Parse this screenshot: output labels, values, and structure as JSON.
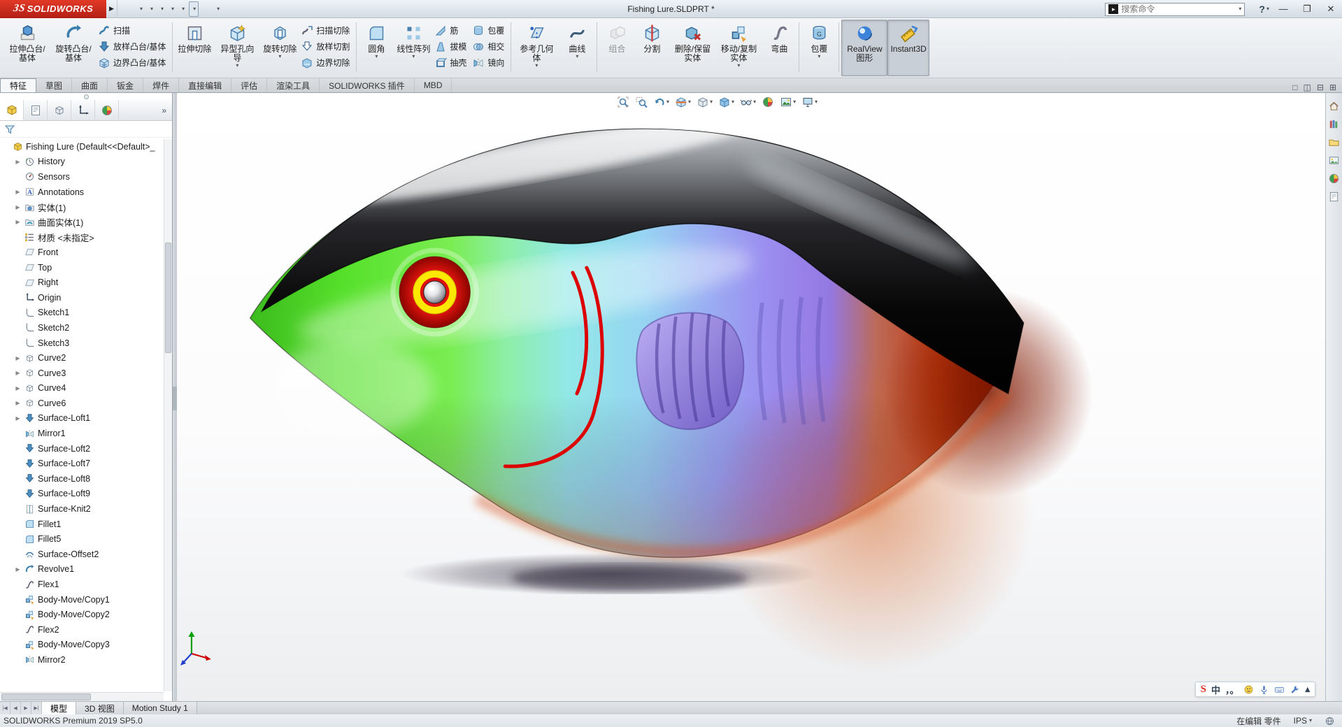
{
  "titlebar": {
    "logo_text": "SOLIDWORKS",
    "logo_prefix": "ЗS",
    "title": "Fishing Lure.SLDPRT *",
    "search_placeholder": "搜索命令",
    "quick_tools": [
      {
        "id": "home",
        "icon": "home",
        "caret": false
      },
      {
        "id": "new-document",
        "icon": "newdoc",
        "caret": true
      },
      {
        "id": "open",
        "icon": "open",
        "caret": true
      },
      {
        "id": "save",
        "icon": "save",
        "caret": true
      },
      {
        "id": "print",
        "icon": "print",
        "caret": true
      },
      {
        "id": "undo",
        "icon": "undo",
        "caret": true
      },
      {
        "id": "select",
        "icon": "select",
        "caret": true,
        "selected": true
      },
      {
        "id": "rebuild-traffic-light",
        "icon": "traffic",
        "caret": false
      },
      {
        "id": "file-properties",
        "icon": "props",
        "caret": false
      },
      {
        "id": "options",
        "icon": "gear",
        "caret": true
      }
    ],
    "window_buttons": [
      {
        "id": "minimize",
        "glyph": "—"
      },
      {
        "id": "restore",
        "glyph": "❐"
      },
      {
        "id": "close",
        "glyph": "✕"
      }
    ]
  },
  "ribbon": {
    "groups": [
      {
        "items": [
          {
            "id": "extruded-boss",
            "label": "拉伸凸台/基体",
            "icon": "extrude"
          },
          {
            "id": "revolved-boss",
            "label": "旋转凸台/基体",
            "icon": "revolve"
          },
          {
            "stack": [
              {
                "id": "swept-boss",
                "label": "扫描",
                "icon": "sweep"
              },
              {
                "id": "lofted-boss",
                "label": "放样凸台/基体",
                "icon": "loft"
              },
              {
                "id": "boundary-boss",
                "label": "边界凸台/基体",
                "icon": "boundary"
              }
            ]
          }
        ]
      },
      {
        "items": [
          {
            "id": "extruded-cut",
            "label": "拉伸切除",
            "icon": "cutextrude"
          },
          {
            "id": "hole-wizard",
            "label": "异型孔向导",
            "icon": "holewizard",
            "caret": true
          },
          {
            "id": "revolved-cut",
            "label": "旋转切除",
            "icon": "cutrevolve",
            "caret": true
          },
          {
            "stack": [
              {
                "id": "swept-cut",
                "label": "扫描切除",
                "icon": "cutsweep"
              },
              {
                "id": "lofted-cut",
                "label": "放样切割",
                "icon": "cutloft"
              },
              {
                "id": "boundary-cut",
                "label": "边界切除",
                "icon": "cutboundary"
              }
            ]
          }
        ]
      },
      {
        "items": [
          {
            "id": "fillet",
            "label": "圆角",
            "icon": "fillet",
            "caret": true
          },
          {
            "id": "linear-pattern",
            "label": "线性阵列",
            "icon": "pattern",
            "caret": true
          },
          {
            "stack": [
              {
                "id": "rib",
                "label": "筋",
                "icon": "rib"
              },
              {
                "id": "draft",
                "label": "拔模",
                "icon": "draft"
              },
              {
                "id": "shell",
                "label": "抽壳",
                "icon": "shell"
              }
            ]
          },
          {
            "stack": [
              {
                "id": "wrap",
                "label": "包覆",
                "icon": "wrap"
              },
              {
                "id": "intersect",
                "label": "相交",
                "icon": "intersect"
              },
              {
                "id": "mirror",
                "label": "镜向",
                "icon": "mirror"
              }
            ]
          }
        ]
      },
      {
        "items": [
          {
            "id": "reference-geometry",
            "label": "参考几何体",
            "icon": "refgeo",
            "caret": true
          },
          {
            "id": "curves",
            "label": "曲线",
            "icon": "curves",
            "caret": true
          }
        ]
      },
      {
        "items": [
          {
            "id": "combine",
            "label": "组合",
            "icon": "combine",
            "disabled": true
          },
          {
            "id": "split",
            "label": "分割",
            "icon": "split"
          },
          {
            "id": "delete-keep-body",
            "label": "删除/保留实体",
            "icon": "deletebody"
          },
          {
            "id": "move-copy-body",
            "label": "移动/复制实体",
            "icon": "movecopy",
            "caret": true
          },
          {
            "id": "flex-bend",
            "label": "弯曲",
            "icon": "bend"
          }
        ]
      },
      {
        "items": [
          {
            "id": "wrap-2",
            "label": "包覆",
            "icon": "wrapcyl",
            "caret": true
          }
        ]
      },
      {
        "items": [
          {
            "id": "realview-graphics",
            "label": "RealView 图形",
            "icon": "realview",
            "active": true
          },
          {
            "id": "instant3d",
            "label": "Instant3D",
            "icon": "instant3d",
            "active": true
          }
        ]
      }
    ]
  },
  "command_tabs": {
    "items": [
      "特征",
      "草图",
      "曲面",
      "钣金",
      "焊件",
      "直接编辑",
      "评估",
      "渲染工具",
      "SOLIDWORKS 插件",
      "MBD"
    ],
    "active_index": 0,
    "corner_icons": [
      {
        "id": "single-view",
        "glyph": "□"
      },
      {
        "id": "two-view-vertical",
        "glyph": "◫"
      },
      {
        "id": "two-view-horizontal",
        "glyph": "⊟"
      },
      {
        "id": "four-view",
        "glyph": "⊞"
      }
    ]
  },
  "feature_panel": {
    "tabs": [
      "featuremanager-tree",
      "property-manager",
      "configuration-manager",
      "dimxpert-manager",
      "display-manager"
    ],
    "expand_chevron": "»",
    "tree_root": {
      "label": "Fishing Lure  (Default<<Default>_",
      "icon": "part"
    },
    "tree_items": [
      {
        "label": "History",
        "icon": "history",
        "expand": true
      },
      {
        "label": "Sensors",
        "icon": "sensors",
        "expand": false
      },
      {
        "label": "Annotations",
        "icon": "annotations",
        "expand": true
      },
      {
        "label": "实体(1)",
        "icon": "solid-folder",
        "expand": true
      },
      {
        "label": "曲面实体(1)",
        "icon": "surface-folder",
        "expand": true
      },
      {
        "label": "材质 <未指定>",
        "icon": "material",
        "expand": false
      },
      {
        "label": "Front",
        "icon": "plane",
        "expand": false
      },
      {
        "label": "Top",
        "icon": "plane",
        "expand": false
      },
      {
        "label": "Right",
        "icon": "plane",
        "expand": false
      },
      {
        "label": "Origin",
        "icon": "origin",
        "expand": false
      },
      {
        "label": "Sketch1",
        "icon": "sketch",
        "expand": false
      },
      {
        "label": "Sketch2",
        "icon": "sketch",
        "expand": false
      },
      {
        "label": "Sketch3",
        "icon": "sketch",
        "expand": false
      },
      {
        "label": "Curve2",
        "icon": "curve",
        "expand": true
      },
      {
        "label": "Curve3",
        "icon": "curve",
        "expand": true
      },
      {
        "label": "Curve4",
        "icon": "curve",
        "expand": true
      },
      {
        "label": "Curve6",
        "icon": "curve",
        "expand": true
      },
      {
        "label": "Surface-Loft1",
        "icon": "loftarrow",
        "expand": true
      },
      {
        "label": "Mirror1",
        "icon": "mirrorf",
        "expand": false
      },
      {
        "label": "Surface-Loft2",
        "icon": "loftarrow",
        "expand": false
      },
      {
        "label": "Surface-Loft7",
        "icon": "loftarrow",
        "expand": false
      },
      {
        "label": "Surface-Loft8",
        "icon": "loftarrow",
        "expand": false
      },
      {
        "label": "Surface-Loft9",
        "icon": "loftarrow",
        "expand": false
      },
      {
        "label": "Surface-Knit2",
        "icon": "knit",
        "expand": false
      },
      {
        "label": "Fillet1",
        "icon": "filletf",
        "expand": false
      },
      {
        "label": "Fillet5",
        "icon": "filletf",
        "expand": false
      },
      {
        "label": "Surface-Offset2",
        "icon": "offset",
        "expand": false
      },
      {
        "label": "Revolve1",
        "icon": "revolvef",
        "expand": true
      },
      {
        "label": "Flex1",
        "icon": "flex",
        "expand": false
      },
      {
        "label": "Body-Move/Copy1",
        "icon": "movecopyf",
        "expand": false
      },
      {
        "label": "Body-Move/Copy2",
        "icon": "movecopyf",
        "expand": false
      },
      {
        "label": "Flex2",
        "icon": "flex",
        "expand": false
      },
      {
        "label": "Body-Move/Copy3",
        "icon": "movecopyf",
        "expand": false
      },
      {
        "label": "Mirror2",
        "icon": "mirrorf",
        "expand": false
      }
    ]
  },
  "headsup_toolbar": [
    {
      "id": "zoom-fit",
      "icon": "zoomfit",
      "caret": false
    },
    {
      "id": "zoom-area",
      "icon": "zoomarea",
      "caret": false
    },
    {
      "id": "previous-view",
      "icon": "prevview",
      "caret": true
    },
    {
      "id": "section-view",
      "icon": "sectioncube",
      "caret": true
    },
    {
      "id": "view-orientation",
      "icon": "vieworient",
      "caret": true
    },
    {
      "id": "display-style",
      "icon": "dispstyle",
      "caret": true
    },
    {
      "id": "hide-show-items",
      "icon": "eyewear",
      "caret": true
    },
    {
      "id": "edit-appearance",
      "icon": "colorball",
      "caret": false
    },
    {
      "id": "apply-scene",
      "icon": "scene",
      "caret": true
    },
    {
      "id": "view-settings",
      "icon": "monitor",
      "caret": true
    }
  ],
  "task_pane": [
    {
      "id": "home",
      "icon": "house"
    },
    {
      "id": "design-library",
      "icon": "books"
    },
    {
      "id": "file-explorer",
      "icon": "folder"
    },
    {
      "id": "view-palette",
      "icon": "palette"
    },
    {
      "id": "appearances",
      "icon": "colorball"
    },
    {
      "id": "custom-properties",
      "icon": "props"
    }
  ],
  "ime_toolbar": [
    {
      "id": "sogou-logo",
      "glyph": "S",
      "cls": "red"
    },
    {
      "id": "lang-mode",
      "glyph": "中",
      "cls": ""
    },
    {
      "id": "punctuation",
      "glyph": "，。",
      "cls": ""
    },
    {
      "id": "emoji",
      "icon": "smiley"
    },
    {
      "id": "mic",
      "icon": "mic"
    },
    {
      "id": "keyboard",
      "icon": "keyboard"
    },
    {
      "id": "toolbox",
      "icon": "wrench"
    },
    {
      "id": "collapse",
      "glyph": "▴",
      "cls": ""
    }
  ],
  "bottom_tabs": {
    "nav": [
      "first",
      "previous",
      "next",
      "last"
    ],
    "tabs": [
      "模型",
      "3D 视图",
      "Motion Study 1"
    ],
    "active_index": 0
  },
  "statusbar": {
    "left_text": "SOLIDWORKS Premium 2019 SP5.0",
    "editing_text": "在编辑 零件",
    "units": "IPS"
  },
  "model": {
    "name": "Fishing Lure",
    "colors": {
      "back": "#0a0a0a",
      "head": "#52d92a",
      "mid": "#92e8e6",
      "body": "#9a8df0",
      "tail": "#b03010",
      "eye_outer": "#e81510",
      "eye_ring": "#ffe800",
      "stripe": "#dd0000",
      "fin": "#a89ae8"
    }
  }
}
